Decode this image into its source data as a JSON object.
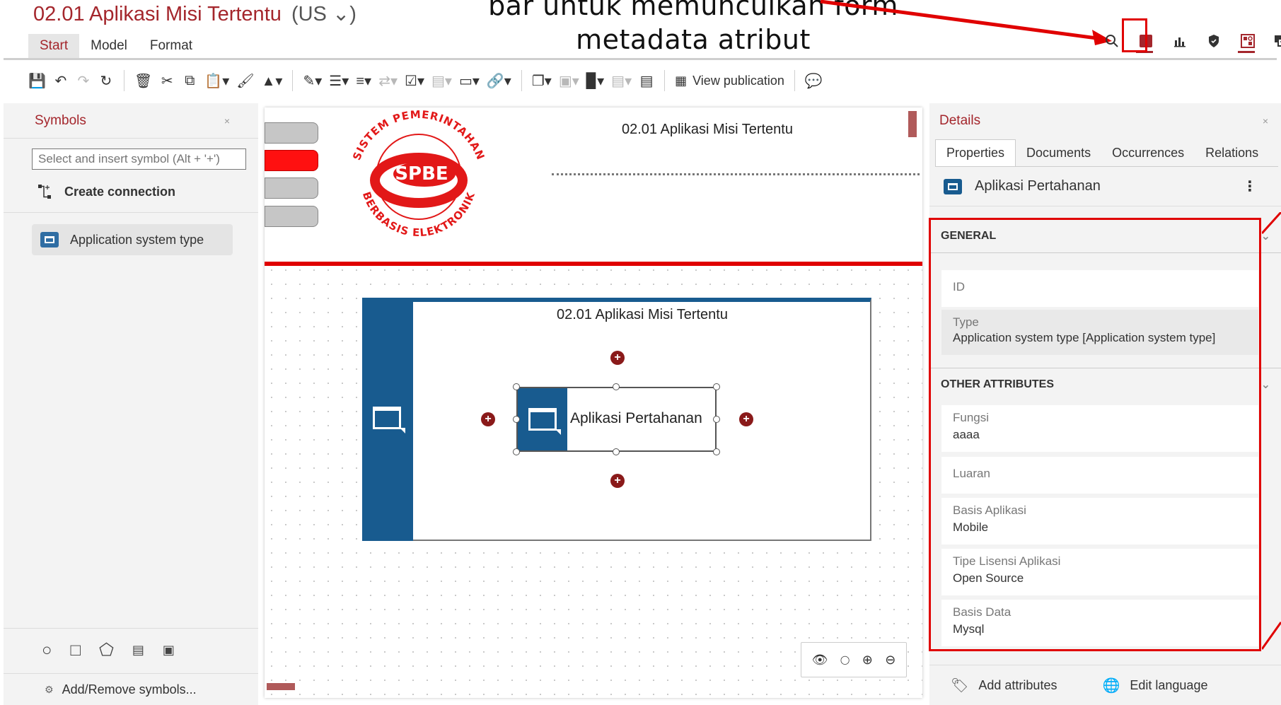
{
  "app": {
    "title": "02.01 Aplikasi Misi Tertentu",
    "language": "(US ⌄)",
    "annotation_line1": "bar untuk memunculkan form",
    "annotation_line2": "metadata atribut"
  },
  "ribbon": {
    "tabs": [
      {
        "label": "Start",
        "active": true
      },
      {
        "label": "Model",
        "active": false
      },
      {
        "label": "Format",
        "active": false
      }
    ],
    "view_publication": "View publication"
  },
  "symbols_panel": {
    "title": "Symbols",
    "close": "×",
    "search_placeholder": "Select and insert symbol (Alt + '+')",
    "create_connection": "Create connection",
    "symbol_item": "Application system type",
    "add_remove": "Add/Remove symbols..."
  },
  "canvas": {
    "header_title": "02.01 Aplikasi Misi Tertentu",
    "logo_top_text": "SISTEM PEMERINTAHAN",
    "logo_center_text": "SPBE",
    "logo_bottom_text": "BERBASIS ELEKTRONIK",
    "group_title": "02.01 Aplikasi Misi Tertentu",
    "object_label": "Aplikasi Pertahanan"
  },
  "details_panel": {
    "title": "Details",
    "close": "×",
    "tabs": [
      "Properties",
      "Documents",
      "Occurrences",
      "Relations"
    ],
    "object_name": "Aplikasi Pertahanan",
    "general_section": "GENERAL",
    "id_label": "ID",
    "type_label": "Type",
    "type_value": "Application system type [Application system type]",
    "other_section": "OTHER ATTRIBUTES",
    "attributes": [
      {
        "label": "Fungsi",
        "value": "aaaa"
      },
      {
        "label": "Luaran",
        "value": ""
      },
      {
        "label": "Basis Aplikasi",
        "value": "Mobile"
      },
      {
        "label": "Tipe Lisensi Aplikasi",
        "value": "Open Source"
      },
      {
        "label": "Basis Data",
        "value": "Mysql"
      }
    ],
    "add_attributes": "Add attributes",
    "edit_language": "Edit language"
  },
  "colors": {
    "brand_red": "#a4262c",
    "highlight_red": "#e00000",
    "object_blue": "#185b8f"
  }
}
